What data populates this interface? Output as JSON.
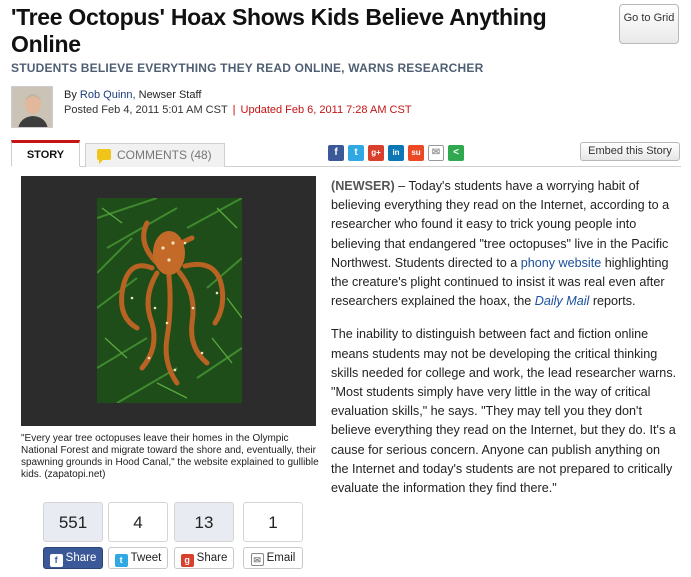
{
  "article": {
    "headline": "'Tree Octopus' Hoax Shows Kids Believe Anything Online",
    "subhead": "STUDENTS BELIEVE EVERYTHING THEY READ ONLINE, WARNS RESEARCHER",
    "byline_prefix": "By",
    "author": "Rob Quinn,",
    "staff": "Newser Staff",
    "posted": "Posted Feb 4, 2011 5:01 AM CST",
    "separator": "|",
    "updated": "Updated Feb 6, 2011 7:28 AM CST",
    "p1": {
      "source": "(NEWSER)",
      "text1": " – Today's students have a worrying habit of believing everything they read on the Internet, according to a researcher who found it easy to trick young people into believing that endangered \"tree octopuses\" live in the Pacific Northwest. Students directed to a ",
      "link1": "phony website",
      "text2": " highlighting the creature's plight continued to insist it was real even after researchers explained the hoax, the ",
      "link2": "Daily Mail",
      "text3": " reports."
    },
    "p2": "The inability to distinguish between fact and fiction online means students may not be developing the critical thinking skills needed for college and work, the lead researcher warns. \"Most students simply have very little in the way of critical evaluation skills,\" he says. \"They may tell you they don't believe everything they read on the Internet, but they do. It's a cause for serious concern. Anyone can publish anything on the Internet and today's students are not prepared to critically evaluate the information they find there.\"",
    "caption": "\"Every year tree octopuses leave their homes in the Olympic National Forest and migrate toward the shore and, eventually, their spawning grounds in Hood Canal,\" the website explained to gullible kids.   (zapatopi.net)"
  },
  "buttons": {
    "go_to_grid": "Go to Grid",
    "embed": "Embed this Story"
  },
  "tabs": {
    "story": "STORY",
    "comments": "COMMENTS (48)"
  },
  "share_icons": [
    "facebook-icon",
    "twitter-icon",
    "google-plus-icon",
    "linkedin-icon",
    "stumbleupon-icon",
    "email-icon",
    "share-icon"
  ],
  "share_counts": {
    "facebook": {
      "count": "551",
      "label": "Share"
    },
    "twitter": {
      "count": "4",
      "label": "Tweet"
    },
    "google": {
      "count": "13",
      "label": "Share"
    },
    "email": {
      "count": "1",
      "label": "Email"
    }
  },
  "colors": {
    "accent_red": "#c41414",
    "link_blue": "#1a4f9c",
    "subhead_gray": "#4f5f73",
    "facebook_blue": "#3b5998"
  }
}
